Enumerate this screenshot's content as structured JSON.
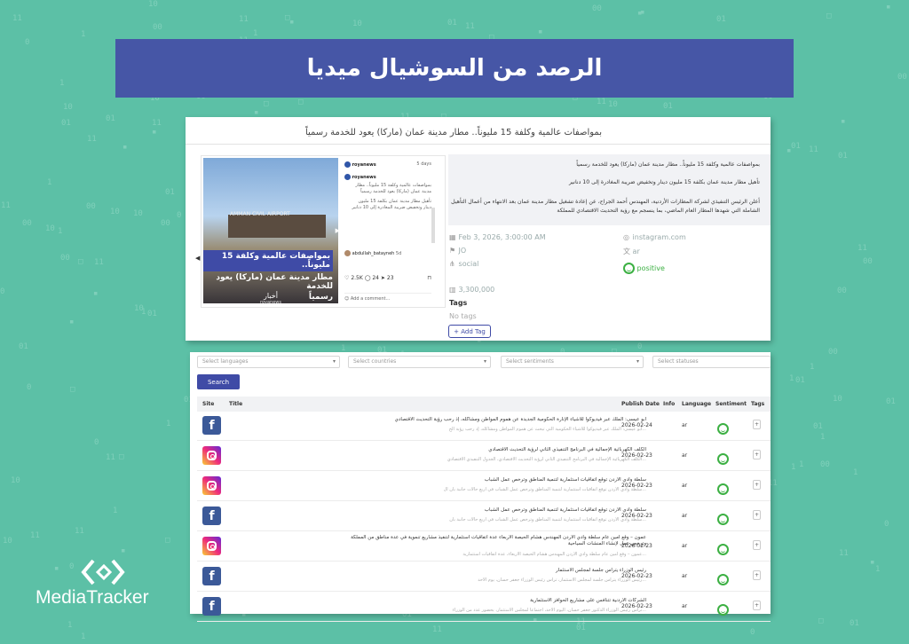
{
  "banner": {
    "title": "الرصد من السوشيال ميديا"
  },
  "post": {
    "headline": "بمواصفات عالمية وكلفة 15 مليوناً.. مطار مدينة عمان (ماركا) يعود للخدمة رسمياً",
    "username": "royanews",
    "time": "5 days",
    "image_overlay_line1": "بمواصفات عالمية وكلفة 15 مليوناً..",
    "image_overlay_line2": "مطار مدينة عمان (ماركا) يعود للخدمة",
    "image_overlay_line3": "رسمياً",
    "image_brand": "أخبار",
    "image_brand_sub": "royanews",
    "airport_sign": "AMMAN CIVIL AIRPORT",
    "caption_lines": [
      "بمواصفات عالمية وكلفة 15 مليوناً.. مطار",
      "مدينة عمان (ماركا) يعود للخدمة رسمياً",
      "تأهيل مطار مدينة عمان بكلفة 15 مليون",
      "دينار وتخفيض ضريبة المغادرة إلى 10 دنانير"
    ],
    "comment_user": "abdullah_batayneh",
    "comment_time": "5d",
    "likes": "2.5K",
    "comments_count": "24",
    "shares": "23",
    "add_comment": "Add a comment..."
  },
  "details": {
    "line1": "بمواصفات عالمية وكلفة 15 مليوناً.. مطار مدينة عمان (ماركا) يعود للخدمة رسمياً",
    "line2": "تأهيل مطار مدينة عمان بكلفة 15 مليون دينار وتخفيض ضريبة المغادرة إلى 10 دنانير",
    "line3": "أعلن الرئيس التنفيذي لشركة المطارات الأردنية، المهندس أحمد الجراح، عن إعادة تشغيل مطار مدينة عمان بعد الانتهاء من أعمال التأهيل",
    "line4": "الشاملة التي شهدها المطار العام الماضي، بما ينسجم مع رؤية التحديث الاقتصادي للمملكة",
    "date": "Feb 3, 2026, 3:00:00 AM",
    "source": "instagram.com",
    "country": "JO",
    "language": "ar",
    "type": "social",
    "sentiment": "positive",
    "reach": "3,300,000",
    "tags_label": "Tags",
    "no_tags": "No tags",
    "add_tag": "+ Add Tag"
  },
  "filters": {
    "languages": "Select languages",
    "countries": "Select countries",
    "sentiments": "Select sentiments",
    "statuses": "Select statuses",
    "search": "Search"
  },
  "table": {
    "headers": {
      "site": "Site",
      "title": "Title",
      "publish_date": "Publish Date",
      "info": "Info",
      "language": "Language",
      "sentiment": "Sentiment",
      "tags": "Tags"
    },
    "rows": [
      {
        "site": "facebook",
        "title": "أبو عيسى: الملك عبر فيديوكوا للأشياء الإنارة الحكومية الجديدة عن هموم المواطن ومشاكله، إذ رحب رؤية التحديث الاقتصادي",
        "sub": "...أبو عيسى: الملك عبر فيديوكوا للأشياء الحكومية التي تبحث عن هموم المواطن ومشاكله، إذ رحب رؤية الح",
        "date": "2026-02-24",
        "lang": "ar"
      },
      {
        "site": "instagram",
        "title": "الكلف الكهربائية الإجمالية في البرنامج التنفيذي الثاني لرؤية التحديث الاقتصادي",
        "sub": "...الكلف الكهربائية الإجمالية في البرنامج التنفيذي الثاني لرؤية التحديث الاقتصادي، الجدول التنفيذي الاقتصادي",
        "date": "2026-02-23",
        "lang": "ar"
      },
      {
        "site": "instagram",
        "title": "سلطة وادي الأردن توقع اتفاقيات استثمارية لتنمية المناطق وترخص عمل الشباب",
        "sub": "...سلطة وادي الأردن توقع اتفاقيات استثمارية لتنمية المناطق وترخص عمل الشباب في أربع حالات جانبة بأن ال",
        "date": "2026-02-23",
        "lang": "ar"
      },
      {
        "site": "facebook",
        "title": "سلطة وادي الأردن توقع اتفاقيات استثمارية لتنمية المناطق وترخص عمل الشباب",
        "sub": "...سلطة وادي الأردن توقع اتفاقيات استثمارية لتنمية المناطق وترخص عمل الشباب في أربع حالات جانبة بأن",
        "date": "2026-02-23",
        "lang": "ar"
      },
      {
        "site": "instagram",
        "title": "عمون – وقع أمين عام سلطة وادي الأردن المهندس هشام الحيصة الأربعاء عدة اتفاقيات استثمارية لتنفيذ مشاريع تنموية في عدة مناطق من المملكة",
        "title2": "وترخص عمل لإنشاء المنشآت السياحية",
        "sub": "...عمون – وقع أمين عام سلطة وادي الأردن المهندس هشام الحيصة الأربعاء، عدة اتفاقيات استثمارية",
        "date": "2026-02-23",
        "lang": "ar"
      },
      {
        "site": "facebook",
        "title": "رئيس الوزراء يترأس جلسة لمجلس الاستثمار",
        "sub": "...رئيس الوزراء يترأس جلسة لمجلس الاستثمار، ترأس رئيس الوزراء جعفر حسان، يوم الأحد",
        "date": "2026-02-23",
        "lang": "ar"
      },
      {
        "site": "facebook",
        "title": "الشركات الأردنية تتنافس على مشاريع الحوافز الاستثمارية",
        "sub": "...ترأس رئيس الوزراء الدكتور جعفر حسان، اليوم الأحد، اجتماعاً لمجلس الاستثمار، بحضور عدد من الوزراء",
        "date": "2026-02-23",
        "lang": "ar"
      }
    ]
  },
  "logo": {
    "text": "MediaTracker"
  },
  "colors": {
    "banner": "#4656a6",
    "accent": "#3f4ba6",
    "positive": "#3cb043",
    "background": "#5cc0a6"
  }
}
